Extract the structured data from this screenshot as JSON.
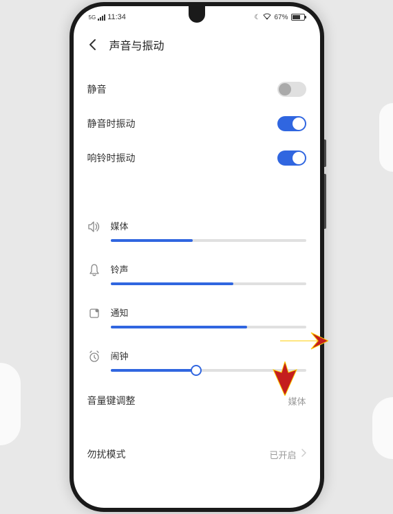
{
  "statusBar": {
    "time": "11:34",
    "networkLabel": "5G",
    "batteryPercent": "67%"
  },
  "header": {
    "title": "声音与振动"
  },
  "toggles": {
    "mute": {
      "label": "静音",
      "on": false
    },
    "vibrateMute": {
      "label": "静音时振动",
      "on": true
    },
    "vibrateRing": {
      "label": "响铃时振动",
      "on": true
    }
  },
  "sliders": {
    "media": {
      "label": "媒体",
      "percent": 42
    },
    "ringtone": {
      "label": "铃声",
      "percent": 63
    },
    "notification": {
      "label": "通知",
      "percent": 70
    },
    "alarm": {
      "label": "闹钟",
      "percent": 44
    }
  },
  "volumeKey": {
    "label": "音量键调整",
    "value": "媒体"
  },
  "dnd": {
    "label": "勿扰模式",
    "value": "已开启"
  }
}
